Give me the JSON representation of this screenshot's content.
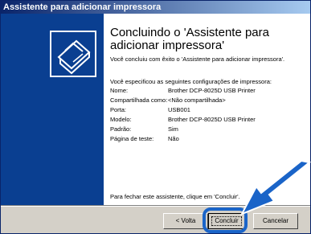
{
  "window": {
    "title": "Assistente para adicionar impressora"
  },
  "wizard": {
    "heading": "Concluindo o 'Assistente para adicionar impressora'",
    "intro": "Você concluiu com êxito o 'Assistente para adicionar impressora'.",
    "specified": "Você especificou as seguintes configurações de impressora:",
    "settings": [
      {
        "label": "Nome:",
        "value": "Brother DCP-8025D USB Printer"
      },
      {
        "label": "Compartilhada como:",
        "value": "<Não compartilhada>"
      },
      {
        "label": "Porta:",
        "value": "USB001"
      },
      {
        "label": "Modelo:",
        "value": "Brother DCP-8025D USB Printer"
      },
      {
        "label": "Padrão:",
        "value": "Sim"
      },
      {
        "label": "Página de teste:",
        "value": "Não"
      }
    ],
    "footer": "Para fechar este assistente, clique em 'Concluir'."
  },
  "buttons": {
    "back": "< Volta",
    "finish": "Concluir",
    "cancel": "Cancelar"
  },
  "colors": {
    "titlebar_start": "#0a246a",
    "left_panel": "#0a3f91",
    "highlight": "#1a64c8"
  }
}
